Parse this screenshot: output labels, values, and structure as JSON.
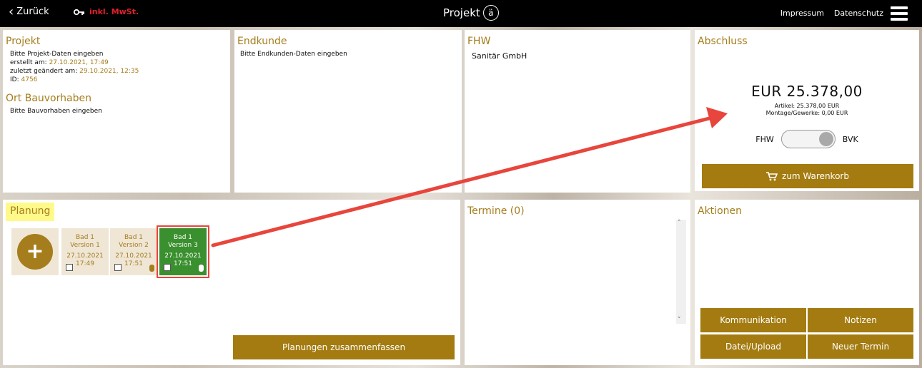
{
  "topbar": {
    "back_label": "Zurück",
    "vat_label": "inkl. MwSt.",
    "title": "Projekt",
    "logo_glyph": "ä",
    "impressum": "Impressum",
    "datenschutz": "Datenschutz"
  },
  "projekt": {
    "heading": "Projekt",
    "prompt": "Bitte Projekt-Daten eingeben",
    "created_label": "erstellt am:",
    "created_value": "27.10.2021, 17:49",
    "changed_label": "zuletzt geändert am:",
    "changed_value": "29.10.2021, 12:35",
    "id_label": "ID:",
    "id_value": "4756"
  },
  "ort": {
    "heading": "Ort Bauvorhaben",
    "prompt": "Bitte Bauvorhaben eingeben"
  },
  "endkunde": {
    "heading": "Endkunde",
    "prompt": "Bitte Endkunden-Daten eingeben"
  },
  "fhw": {
    "heading": "FHW",
    "company": "Sanitär GmbH"
  },
  "abschluss": {
    "heading": "Abschluss",
    "total": "EUR 25.378,00",
    "artikel": "Artikel: 25.378,00 EUR",
    "montage": "Montage/Gewerke: 0,00 EUR",
    "toggle_left": "FHW",
    "toggle_right": "BVK",
    "cart_button": "zum Warenkorb"
  },
  "planung": {
    "heading": "Planung",
    "tiles": [
      {
        "name": "Bad 1",
        "version": "Version 1",
        "date": "27.10.2021",
        "time": "17:49"
      },
      {
        "name": "Bad 1",
        "version": "Version 2",
        "date": "27.10.2021",
        "time": "17:51"
      },
      {
        "name": "Bad 1",
        "version": "Version 3",
        "date": "27.10.2021",
        "time": "17:51"
      }
    ],
    "merge_button": "Planungen zusammenfassen"
  },
  "termine": {
    "heading": "Termine (0)"
  },
  "aktionen": {
    "heading": "Aktionen",
    "kommunikation": "Kommunikation",
    "notizen": "Notizen",
    "datei": "Datei/Upload",
    "termin": "Neuer Termin"
  },
  "colors": {
    "gold": "#a57d1c",
    "button": "#a37b10",
    "active_tile": "#3a8f2e",
    "annotation": "#e8453c",
    "highlight": "#fff98a"
  }
}
